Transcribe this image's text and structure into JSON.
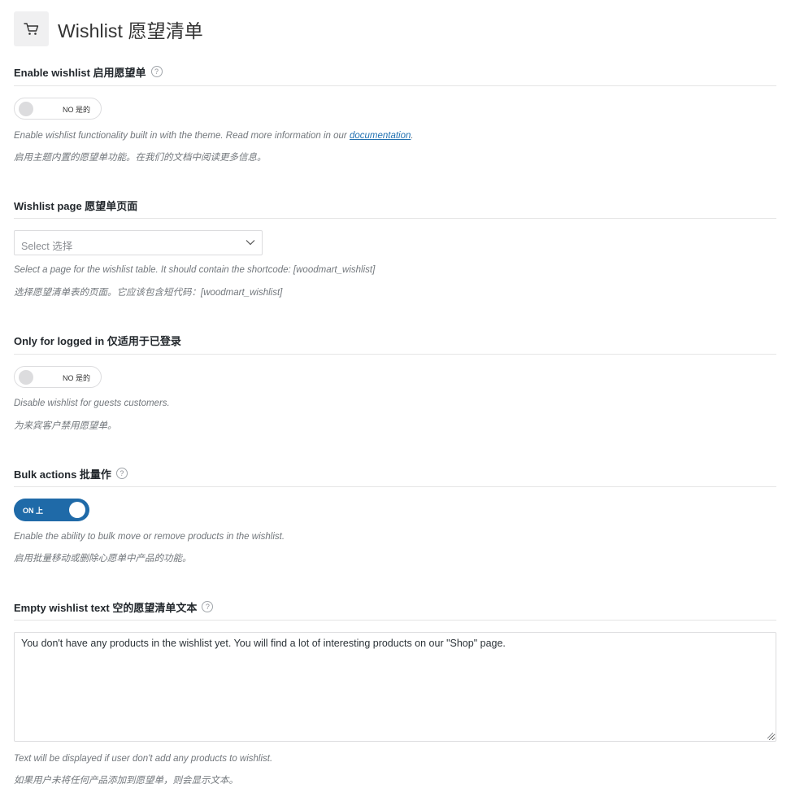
{
  "header": {
    "title": "Wishlist  愿望清单",
    "icon": "cart-icon"
  },
  "enable_wishlist": {
    "title": "Enable wishlist  启用愿望单",
    "toggle_state": "off",
    "toggle_text": "NO  是的",
    "desc_en_prefix": "Enable wishlist functionality built in with the theme. Read more information in our ",
    "desc_en_link": "documentation",
    "desc_en_suffix": ".",
    "desc_zh": "启用主题内置的愿望单功能。在我们的文档中阅读更多信息。"
  },
  "wishlist_page": {
    "title": "Wishlist page  愿望单页面",
    "select_placeholder": "Select  选择",
    "desc_en": "Select a page for the wishlist table. It should contain the shortcode: [woodmart_wishlist]",
    "desc_zh": "选择愿望清单表的页面。它应该包含短代码：[woodmart_wishlist]"
  },
  "only_logged_in": {
    "title": "Only for logged in  仅适用于已登录",
    "toggle_state": "off",
    "toggle_text": "NO  是的",
    "desc_en": "Disable wishlist for guests customers.",
    "desc_zh": "为来宾客户禁用愿望单。"
  },
  "bulk_actions": {
    "title": "Bulk actions  批量作",
    "toggle_state": "on",
    "toggle_text": "ON  上",
    "desc_en": "Enable the ability to bulk move or remove products in the wishlist.",
    "desc_zh": "启用批量移动或删除心愿单中产品的功能。"
  },
  "empty_text": {
    "title": "Empty wishlist text  空的愿望清单文本",
    "value": "You don't have any products in the wishlist yet. You will find a lot of interesting products on our \"Shop\" page.",
    "desc_en": "Text will be displayed if user don't add any products to wishlist.",
    "desc_zh": "如果用户未将任何产品添加到愿望单，则会显示文本。"
  },
  "colors": {
    "toggle_on": "#1f6aa8",
    "link": "#2271b1",
    "description": "#72777c"
  }
}
